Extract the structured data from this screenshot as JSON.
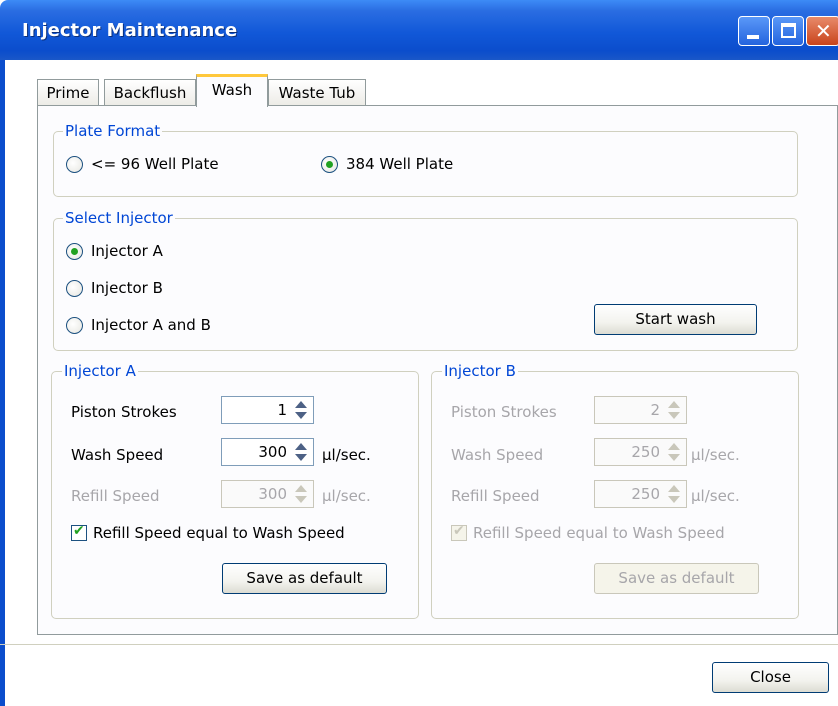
{
  "window": {
    "title": "Injector Maintenance"
  },
  "tabs": [
    {
      "label": "Prime",
      "active": false
    },
    {
      "label": "Backflush",
      "active": false
    },
    {
      "label": "Wash",
      "active": true
    },
    {
      "label": "Waste Tub",
      "active": false
    }
  ],
  "plate_format": {
    "label": "Plate Format",
    "options": [
      {
        "label": "<= 96 Well Plate",
        "checked": false
      },
      {
        "label": "384 Well Plate",
        "checked": true
      }
    ]
  },
  "select_injector": {
    "label": "Select Injector",
    "options": [
      {
        "label": "Injector A",
        "checked": true
      },
      {
        "label": "Injector B",
        "checked": false
      },
      {
        "label": "Injector A and B",
        "checked": false
      }
    ],
    "start_wash_label": "Start wash"
  },
  "injector_a": {
    "label": "Injector A",
    "piston_strokes_label": "Piston Strokes",
    "piston_strokes_value": "1",
    "wash_speed_label": "Wash Speed",
    "wash_speed_value": "300",
    "wash_speed_unit": "µl/sec.",
    "refill_speed_label": "Refill Speed",
    "refill_speed_value": "300",
    "refill_speed_unit": "µl/sec.",
    "refill_equal_label": "Refill Speed equal to Wash Speed",
    "refill_equal_checked": true,
    "save_default_label": "Save as default"
  },
  "injector_b": {
    "label": "Injector B",
    "piston_strokes_label": "Piston Strokes",
    "piston_strokes_value": "2",
    "wash_speed_label": "Wash Speed",
    "wash_speed_value": "250",
    "wash_speed_unit": "µl/sec.",
    "refill_speed_label": "Refill Speed",
    "refill_speed_value": "250",
    "refill_speed_unit": "µl/sec.",
    "refill_equal_label": "Refill Speed equal to Wash Speed",
    "refill_equal_checked": true,
    "save_default_label": "Save as default"
  },
  "footer": {
    "close_label": "Close"
  },
  "colors": {
    "title_bar": "#1158d8",
    "group_label": "#0046d5",
    "radio_check": "#21a121",
    "active_tab_highlight": "#ffc83c"
  }
}
